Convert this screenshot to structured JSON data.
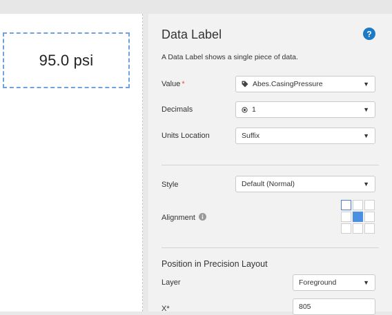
{
  "canvas": {
    "widget_value": "95.0 psi"
  },
  "panel": {
    "title": "Data Label",
    "description": "A Data Label shows a single piece of data.",
    "fields": {
      "value": {
        "label": "Value",
        "required_mark": "*",
        "selected": "Abes.CasingPressure",
        "icon": "tag-icon"
      },
      "decimals": {
        "label": "Decimals",
        "selected": "1",
        "icon": "radio-icon"
      },
      "units_location": {
        "label": "Units Location",
        "selected": "Suffix"
      },
      "style": {
        "label": "Style",
        "selected": "Default (Normal)"
      },
      "alignment": {
        "label": "Alignment",
        "selected_cell": "center",
        "cells": [
          "top-left",
          "top-center",
          "top-right",
          "middle-left",
          "center",
          "middle-right",
          "bottom-left",
          "bottom-center",
          "bottom-right"
        ]
      }
    },
    "position": {
      "section_title": "Position in Precision Layout",
      "layer": {
        "label": "Layer",
        "selected": "Foreground"
      },
      "x": {
        "label": "X*",
        "value": "805"
      }
    }
  },
  "colors": {
    "accent": "#4a90e2",
    "help": "#1c7bc4",
    "required": "#d9534f"
  }
}
